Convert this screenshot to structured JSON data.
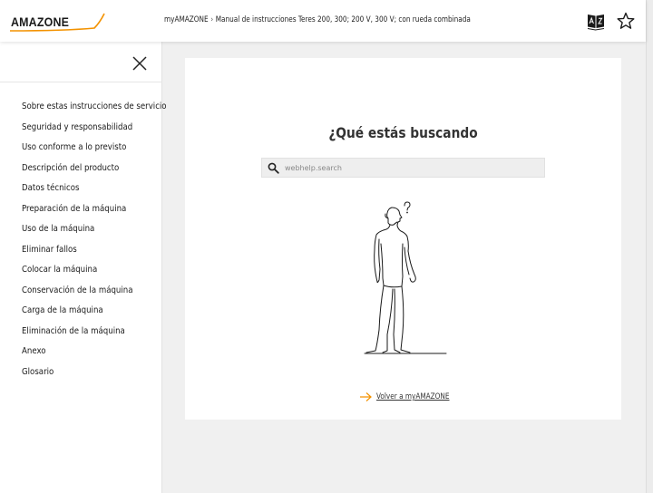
{
  "header": {
    "logo_text": "AMAZONE",
    "breadcrumb": [
      "myAMAZONE",
      "Manual de instrucciones Teres 200, 300; 200 V, 300 V; con rueda combinada"
    ],
    "breadcrumb_separator": "›",
    "icons": [
      "glossary-book-icon",
      "star-icon"
    ]
  },
  "sidebar": {
    "close_icon": "close-icon",
    "items": [
      "Sobre estas instrucciones de servicio",
      "Seguridad y responsabilidad",
      "Uso conforme a lo previsto",
      "Descripción del producto",
      "Datos técnicos",
      "Preparación de la máquina",
      "Uso de la máquina",
      "Eliminar fallos",
      "Colocar la máquina",
      "Conservación de la máquina",
      "Carga de la máquina",
      "Eliminación de la máquina",
      "Anexo",
      "Glosario"
    ]
  },
  "main": {
    "title": "¿Qué estás buscando",
    "search": {
      "value": "",
      "placeholder": "webhelp.search",
      "icon": "search-icon"
    },
    "illustration": "thinking-person-icon",
    "back_link": "Volver a myAMAZONE"
  },
  "colors": {
    "accent": "#f39200",
    "text": "#222222",
    "page_bg": "#f0f0f0"
  }
}
